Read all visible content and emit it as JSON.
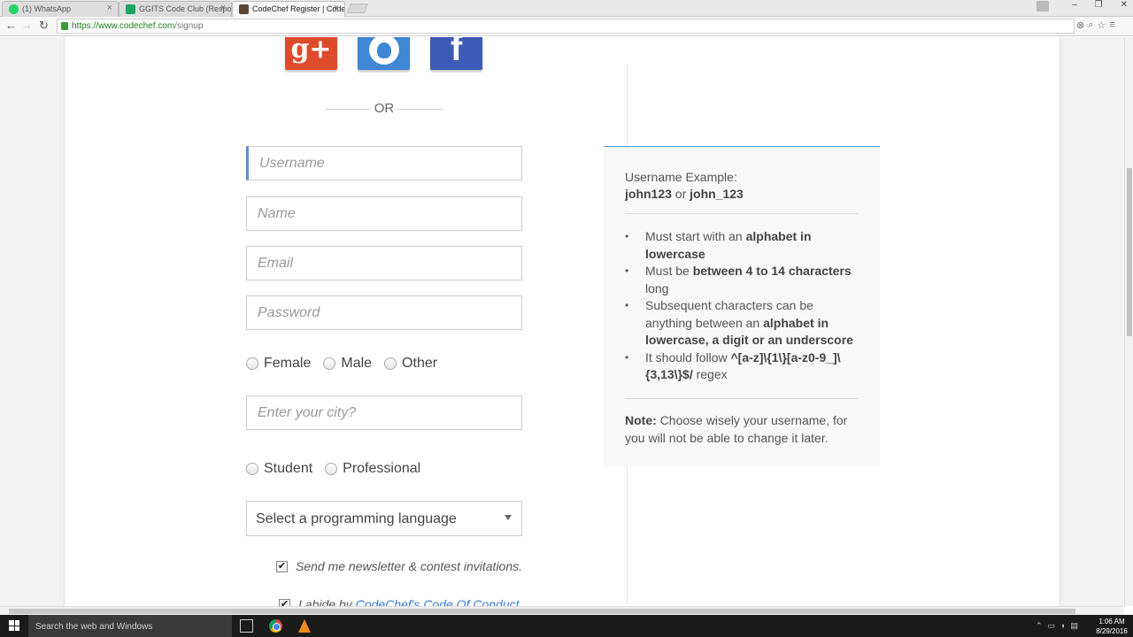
{
  "browser": {
    "tabs": [
      {
        "title": "(1) WhatsApp",
        "favicon_color": "#25d366",
        "active": false
      },
      {
        "title": "GGITS Code Club (Respo",
        "favicon_color": "#1fa463",
        "active": false
      },
      {
        "title": "CodeChef Register | Code",
        "favicon_color": "#5b4636",
        "active": true
      }
    ],
    "url_host": "https://www.codechef.com",
    "url_path": "/signup"
  },
  "signup": {
    "or_text": "OR",
    "username_placeholder": "Username",
    "name_placeholder": "Name",
    "email_placeholder": "Email",
    "password_placeholder": "Password",
    "gender_options": [
      "Female",
      "Male",
      "Other"
    ],
    "city_placeholder": "Enter your city?",
    "occupation_options": [
      "Student",
      "Professional"
    ],
    "language_select": "Select a programming language",
    "newsletter_label": "Send me newsletter & contest invitations.",
    "coc_label": "I abide by",
    "coc_link": "CodeChef's Code Of Conduct"
  },
  "info": {
    "example_label": "Username Example:",
    "example_a": "john123",
    "example_or": "or",
    "example_b": "john_123",
    "rule1_a": "Must start with an ",
    "rule1_b": "alphabet in lowercase",
    "rule2_a": "Must be ",
    "rule2_b": "between 4 to 14 characters",
    "rule2_c": " long",
    "rule3_a": "Subsequent characters can be anything between an ",
    "rule3_b": "alphabet in lowercase, a digit or an underscore",
    "rule4_a": "It should follow ",
    "rule4_b": "^[a-z]\\{1\\}[a-z0-9_]\\{3,13\\}$/",
    "rule4_c": " regex",
    "note_label": "Note:",
    "note_text": " Choose wisely your username, for you will not be able to change it later."
  },
  "taskbar": {
    "search_placeholder": "Search the web and Windows",
    "time": "1:06 AM",
    "date": "8/29/2016"
  },
  "colors": {
    "google_plus": "#dd4b2b",
    "github": "#3f86d3",
    "facebook": "#3b5bb5",
    "focus_accent": "#5b8fd6"
  }
}
